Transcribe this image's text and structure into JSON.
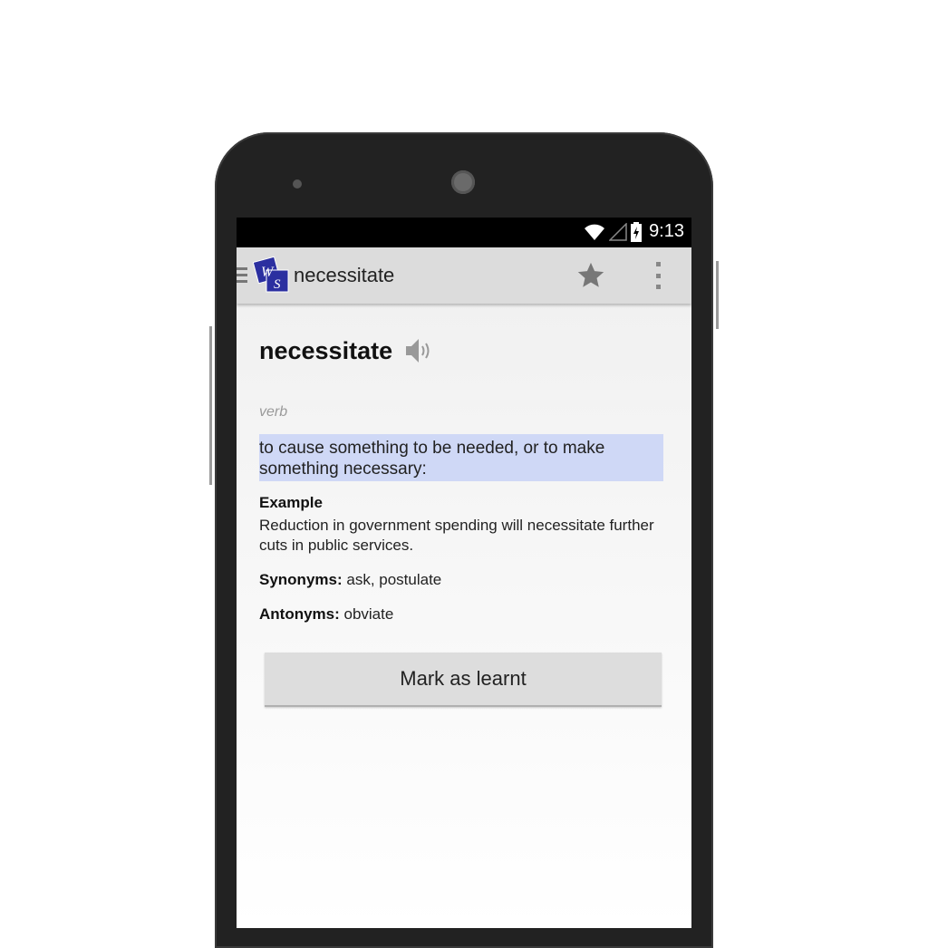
{
  "colors": {
    "background": "#dedede",
    "phone": "#222222",
    "appbar": "#dcdcdc",
    "highlight": "#cfd8f6",
    "logo": "#2b2fa0"
  },
  "status_bar": {
    "time": "9:13",
    "icons": [
      "wifi-icon",
      "signal-icon",
      "battery-charging-icon"
    ]
  },
  "app_bar": {
    "logo_letters": [
      "W",
      "S"
    ],
    "title": "necessitate",
    "actions": [
      "star-icon",
      "overflow-menu-icon"
    ]
  },
  "entry": {
    "word": "necessitate",
    "part_of_speech": "verb",
    "definition": "to cause something to be needed, or to make something necessary:",
    "example_label": "Example",
    "example_text": "Reduction in government spending will necessitate further cuts in public services.",
    "synonyms_label": "Synonyms:",
    "synonyms": "ask, postulate",
    "antonyms_label": "Antonyms:",
    "antonyms": "obviate",
    "mark_button": "Mark as learnt"
  }
}
